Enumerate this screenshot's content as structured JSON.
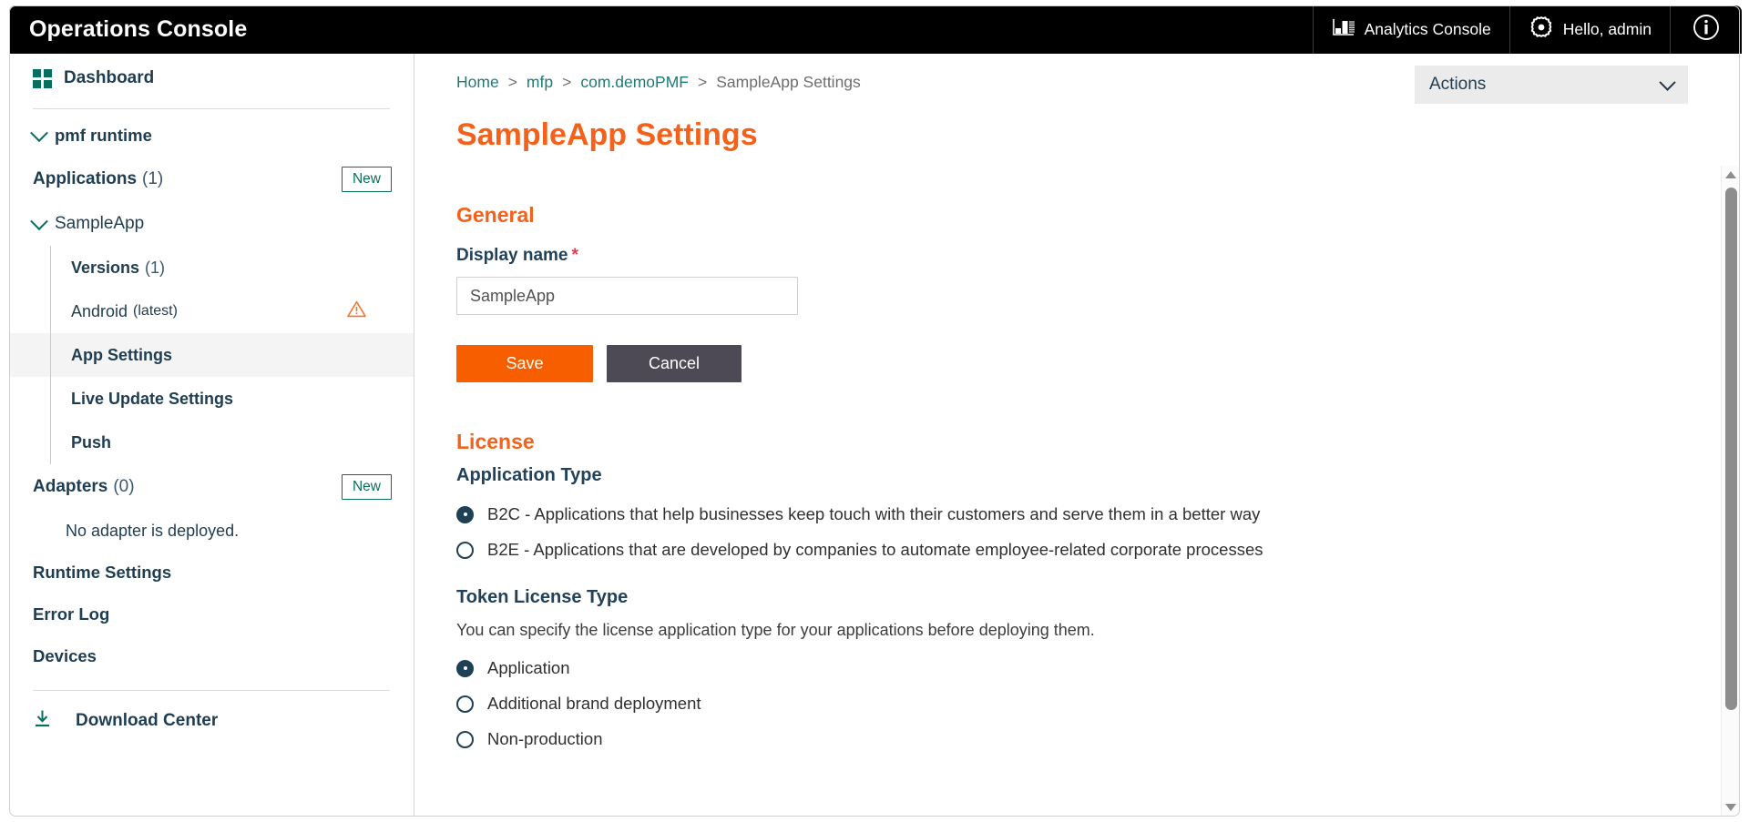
{
  "header": {
    "brand": "Operations Console",
    "analytics_label": "Analytics Console",
    "user_label": "Hello, admin",
    "analytics_icon": "bar-chart-icon",
    "gear_icon": "gear-icon",
    "info_icon": "info-circle-icon"
  },
  "sidebar": {
    "dashboard": "Dashboard",
    "dashboard_icon": "grid-icon",
    "runtime": "pmf runtime",
    "applications_label": "Applications",
    "applications_count": "(1)",
    "applications_new": "New",
    "app_name": "SampleApp",
    "versions_label": "Versions",
    "versions_count": "(1)",
    "android_label": "Android",
    "android_note": "(latest)",
    "android_warning_icon": "warning-triangle-icon",
    "app_settings": "App Settings",
    "live_update_settings": "Live Update Settings",
    "push": "Push",
    "adapters_label": "Adapters",
    "adapters_count": "(0)",
    "adapters_new": "New",
    "no_adapter": "No adapter is deployed.",
    "runtime_settings": "Runtime Settings",
    "error_log": "Error Log",
    "devices": "Devices",
    "download_center": "Download Center",
    "download_icon": "download-icon"
  },
  "breadcrumb": {
    "items": [
      "Home",
      "mfp",
      "com.demoPMF",
      "SampleApp Settings"
    ],
    "separator": ">"
  },
  "actions": {
    "label": "Actions",
    "chevron_icon": "chevron-down-icon"
  },
  "main": {
    "page_title": "SampleApp Settings",
    "general_heading": "General",
    "display_name_label": "Display name",
    "required_mark": "*",
    "display_name_value": "SampleApp",
    "display_name_placeholder": "Display name",
    "save_label": "Save",
    "cancel_label": "Cancel",
    "license_heading": "License",
    "application_type_label": "Application Type",
    "application_type_options": [
      "B2C - Applications that help businesses keep touch with their customers and serve them in a better way",
      "B2E - Applications that are developed by companies to automate employee-related corporate processes"
    ],
    "token_license_label": "Token License Type",
    "token_license_help": "You can specify the license application type for your applications before deploying them.",
    "token_license_options": [
      "Application",
      "Additional brand deployment",
      "Non-production"
    ]
  },
  "colors": {
    "accent_orange": "#f4611a",
    "save_orange": "#f75e00",
    "teal": "#0a6e5e",
    "link_teal": "#1b7b78",
    "navy": "#1f3d52",
    "cancel_gray": "#4d4a55",
    "required_red": "#e8384f"
  },
  "scrollbar": {
    "up_icon": "scroll-up-arrow-icon",
    "down_icon": "scroll-down-arrow-icon",
    "thumb": "scrollbar-thumb"
  }
}
